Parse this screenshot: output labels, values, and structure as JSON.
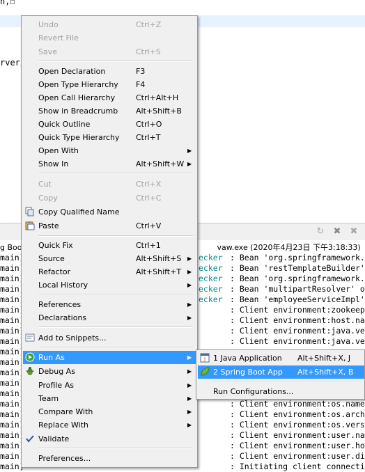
{
  "editor": {
    "line1": "n,☐",
    "line2": "rver/"
  },
  "console": {
    "title": "g Boo",
    "process": "vaw.exe (2020年4月23日 下午3:18:33)",
    "lines": [
      {
        "left": "main]",
        "mid": "ecker",
        "right": ": Bean 'org.springframework.b"
      },
      {
        "left": "main]",
        "mid": "ecker",
        "right": ": Bean 'restTemplateBuilder'"
      },
      {
        "left": "main]",
        "mid": "ecker",
        "right": ": Bean 'org.springframework.b"
      },
      {
        "left": "main]",
        "mid": "ecker",
        "right": ": Bean 'multipartResolver' of"
      },
      {
        "left": "main]",
        "mid": "ecker",
        "right": ": Bean 'employeeServiceImpl'"
      },
      {
        "left": "main]",
        "mid": "",
        "right": ": Client environment:zookeepe"
      },
      {
        "left": "main]",
        "mid": "",
        "right": ": Client environment:host.nam"
      },
      {
        "left": "main]",
        "mid": "",
        "right": ": Client environment:java.ver"
      },
      {
        "left": "main]",
        "mid": "",
        "right": ": Client environment:java.ven"
      },
      {
        "left": "main]",
        "mid": "",
        "right": ""
      },
      {
        "left": "main]",
        "mid": "",
        "right": ""
      },
      {
        "left": "main]",
        "mid": "",
        "right": ""
      },
      {
        "left": "main]",
        "mid": "",
        "right": ""
      },
      {
        "left": "main]",
        "mid": "",
        "right": ""
      },
      {
        "left": "main]",
        "mid": "",
        "right": ": Client environment:os.name"
      },
      {
        "left": "main]",
        "mid": "",
        "right": ": Client environment:os.arch"
      },
      {
        "left": "main]",
        "mid": "",
        "right": ": Client environment:os.vers"
      },
      {
        "left": "main]",
        "mid": "",
        "right": ": Client environment:user.nam"
      },
      {
        "left": "main]",
        "mid": "",
        "right": ": Client environment:user.hom"
      },
      {
        "left": "main]",
        "mid": "",
        "right": ": Client environment:user.dir"
      },
      {
        "left": "main]",
        "mid": "",
        "right": ": Initiating client connecti"
      }
    ]
  },
  "menu": {
    "undo": {
      "label": "Undo",
      "shortcut": "Ctrl+Z"
    },
    "revert": {
      "label": "Revert File"
    },
    "save": {
      "label": "Save",
      "shortcut": "Ctrl+S"
    },
    "open_declaration": {
      "label": "Open Declaration",
      "shortcut": "F3"
    },
    "open_type_hierarchy": {
      "label": "Open Type Hierarchy",
      "shortcut": "F4"
    },
    "open_call_hierarchy": {
      "label": "Open Call Hierarchy",
      "shortcut": "Ctrl+Alt+H"
    },
    "show_in_breadcrumb": {
      "label": "Show in Breadcrumb",
      "shortcut": "Alt+Shift+B"
    },
    "quick_outline": {
      "label": "Quick Outline",
      "shortcut": "Ctrl+O"
    },
    "quick_type_hierarchy": {
      "label": "Quick Type Hierarchy",
      "shortcut": "Ctrl+T"
    },
    "open_with": {
      "label": "Open With"
    },
    "show_in": {
      "label": "Show In",
      "shortcut": "Alt+Shift+W"
    },
    "cut": {
      "label": "Cut",
      "shortcut": "Ctrl+X"
    },
    "copy": {
      "label": "Copy",
      "shortcut": "Ctrl+C"
    },
    "copy_qualified": {
      "label": "Copy Qualified Name"
    },
    "paste": {
      "label": "Paste",
      "shortcut": "Ctrl+V"
    },
    "quick_fix": {
      "label": "Quick Fix",
      "shortcut": "Ctrl+1"
    },
    "source": {
      "label": "Source",
      "shortcut": "Alt+Shift+S"
    },
    "refactor": {
      "label": "Refactor",
      "shortcut": "Alt+Shift+T"
    },
    "local_history": {
      "label": "Local History"
    },
    "references": {
      "label": "References"
    },
    "declarations": {
      "label": "Declarations"
    },
    "add_to_snippets": {
      "label": "Add to Snippets..."
    },
    "run_as": {
      "label": "Run As"
    },
    "debug_as": {
      "label": "Debug As"
    },
    "profile_as": {
      "label": "Profile As"
    },
    "team": {
      "label": "Team"
    },
    "compare_with": {
      "label": "Compare With"
    },
    "replace_with": {
      "label": "Replace With"
    },
    "validate": {
      "label": "Validate"
    },
    "preferences": {
      "label": "Preferences..."
    }
  },
  "submenu": {
    "java_app": {
      "label": "1 Java Application",
      "shortcut": "Alt+Shift+X, J"
    },
    "spring_boot": {
      "label": "2 Spring Boot App",
      "shortcut": "Alt+Shift+X, B"
    },
    "run_configs": {
      "label": "Run Configurations..."
    }
  },
  "colors": {
    "selection": "#3399ff",
    "menu_bg": "#f0f0f0",
    "console_class": "#008a8c"
  }
}
